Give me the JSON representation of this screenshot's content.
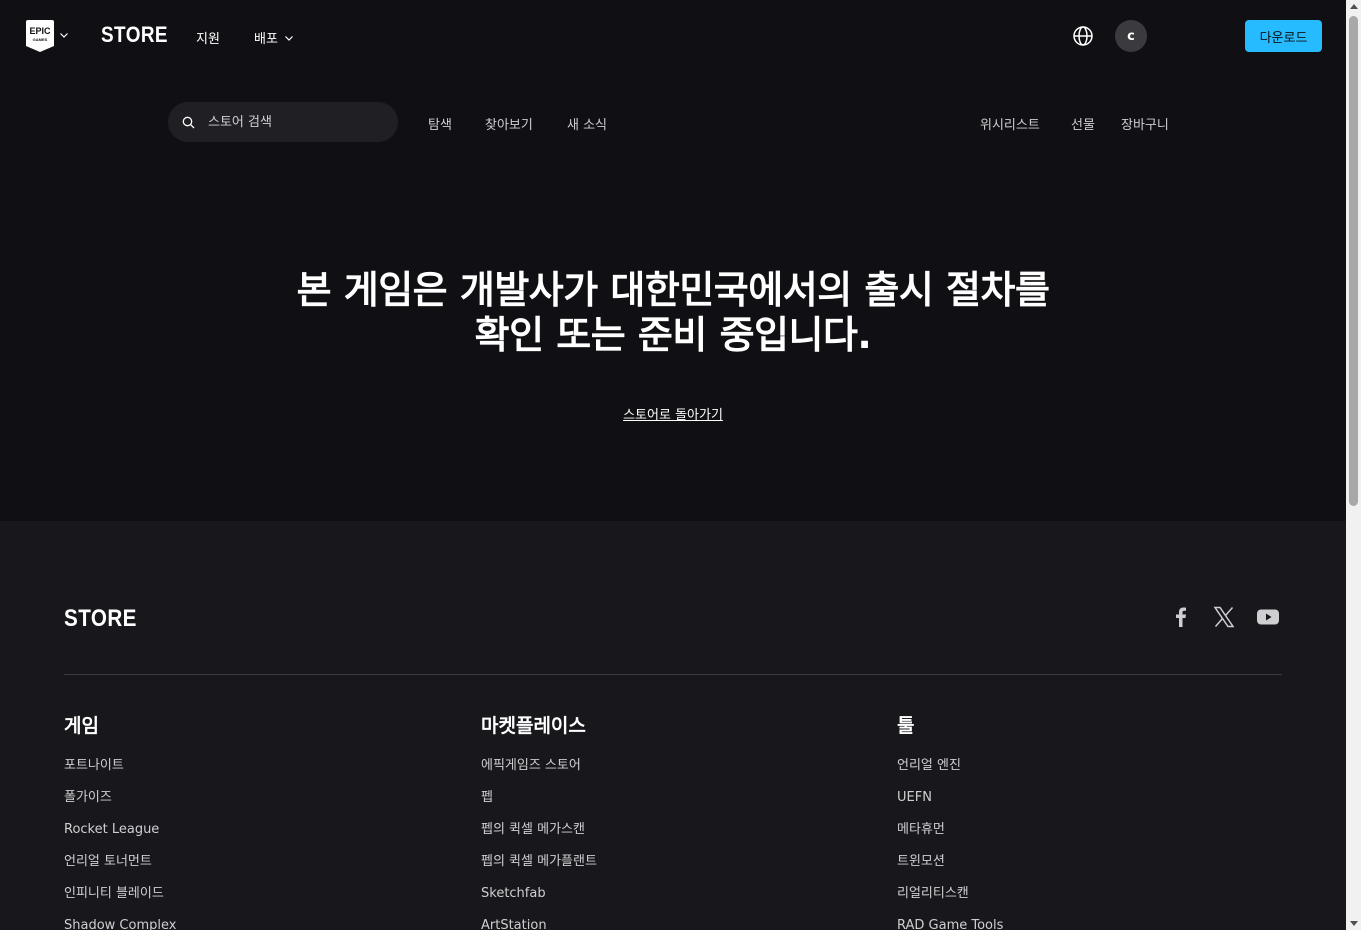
{
  "topnav": {
    "logo_text": "EPIC GAMES",
    "store_label": "STORE",
    "support_label": "지원",
    "distribute_label": "배포",
    "avatar_letter": "c",
    "download_label": "다운로드"
  },
  "subnav": {
    "search_placeholder": "스토어 검색",
    "discover": "탐색",
    "browse": "찾아보기",
    "news": "새 소식",
    "wishlist": "위시리스트",
    "gifts": "선물",
    "cart": "장바구니"
  },
  "hero": {
    "line1": "본 게임은 개발사가 대한민국에서의 출시 절차를",
    "line2": "확인 또는 준비 중입니다.",
    "back_link": "스토어로 돌아가기"
  },
  "footer": {
    "store_label": "STORE",
    "columns": [
      {
        "heading": "게임",
        "items": [
          "포트나이트",
          "폴가이즈",
          "Rocket League",
          "언리얼 토너먼트",
          "인피니티 블레이드",
          "Shadow Complex"
        ]
      },
      {
        "heading": "마켓플레이스",
        "items": [
          "에픽게임즈 스토어",
          "펩",
          "펩의 퀵셀 메가스캔",
          "펩의 퀵셀 메가플랜트",
          "Sketchfab",
          "ArtStation"
        ]
      },
      {
        "heading": "툴",
        "items": [
          "언리얼 엔진",
          "UEFN",
          "메타휴먼",
          "트윈모션",
          "리얼리티스캔",
          "RAD Game Tools"
        ]
      }
    ]
  },
  "icons": {
    "logo": "epic-games-logo",
    "globe": "globe-icon",
    "search": "search-icon",
    "facebook": "facebook-icon",
    "x": "x-icon",
    "youtube": "youtube-icon"
  },
  "colors": {
    "background": "#101014",
    "footer_background": "#18181c",
    "accent": "#26bbff",
    "search_bg": "#202024"
  }
}
